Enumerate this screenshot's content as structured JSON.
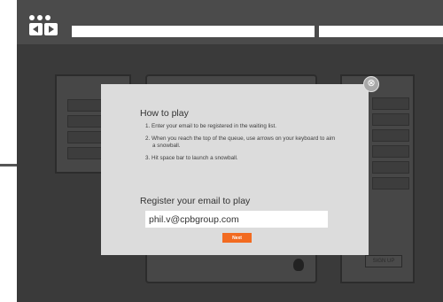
{
  "modal": {
    "title": "How to play",
    "steps": [
      "1. Enter your email to be registered in the waiting list.",
      "2. When you reach the top of the queue, use arrows on your keyboard to aim a snowball.",
      "3. Hit space bar to launch a snowball."
    ],
    "register_heading": "Register your email to play",
    "email_value": "phil.v@cpbgroup.com",
    "next_label": "Next",
    "close_icon": "close-icon"
  },
  "background": {
    "signup_label": "SIGN UP"
  },
  "colors": {
    "accent": "#f26b21",
    "chrome": "#4b4b4b",
    "overlay": "#3a3a3a",
    "modal_bg": "#dcdcdc"
  }
}
